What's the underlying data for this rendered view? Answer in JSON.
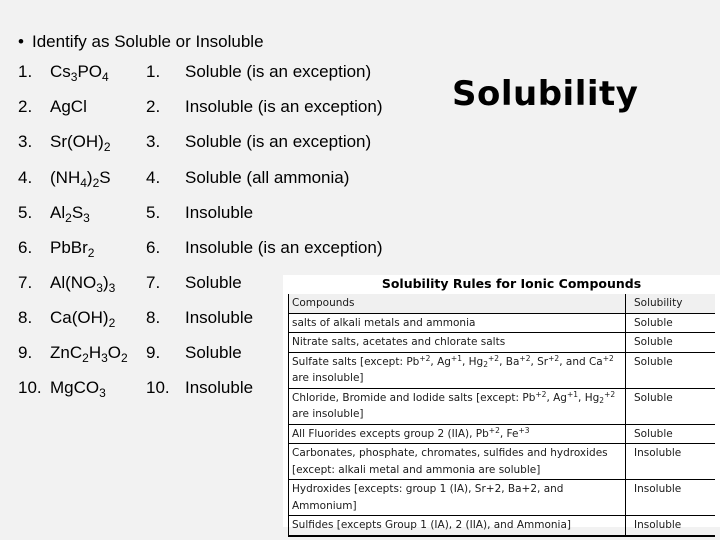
{
  "slide": {
    "title": "Solubility",
    "bullet": "Identify as Soluble or Insoluble",
    "bullet_icon": "bullet-dot"
  },
  "questions": [
    {
      "num": "1.",
      "formula_parts": [
        [
          "Cs",
          ""
        ],
        [
          "3",
          "sub"
        ],
        [
          "PO",
          ""
        ],
        [
          "4",
          "sub"
        ]
      ],
      "answer_num": "1.",
      "answer": "Soluble (is an exception)"
    },
    {
      "num": "2.",
      "formula_parts": [
        [
          "AgCl",
          ""
        ]
      ],
      "answer_num": "2.",
      "answer": "Insoluble (is an exception)"
    },
    {
      "num": "3.",
      "formula_parts": [
        [
          "Sr(OH)",
          ""
        ],
        [
          "2",
          "sub"
        ]
      ],
      "answer_num": "3.",
      "answer": "Soluble (is an exception)"
    },
    {
      "num": "4.",
      "formula_parts": [
        [
          "(NH",
          ""
        ],
        [
          "4",
          "sub"
        ],
        [
          ")",
          ""
        ],
        [
          "2",
          "sub"
        ],
        [
          "S",
          ""
        ]
      ],
      "answer_num": "4.",
      "answer": "Soluble (all ammonia)"
    },
    {
      "num": "5.",
      "formula_parts": [
        [
          "Al",
          ""
        ],
        [
          "2",
          "sub"
        ],
        [
          "S",
          ""
        ],
        [
          "3",
          "sub"
        ]
      ],
      "answer_num": "5.",
      "answer": "Insoluble"
    },
    {
      "num": "6.",
      "formula_parts": [
        [
          "PbBr",
          ""
        ],
        [
          "2",
          "sub"
        ]
      ],
      "answer_num": "6.",
      "answer": "Insoluble (is an exception)"
    },
    {
      "num": "7.",
      "formula_parts": [
        [
          "Al(NO",
          ""
        ],
        [
          "3",
          "sub"
        ],
        [
          ")",
          ""
        ],
        [
          "3",
          "sub"
        ]
      ],
      "answer_num": "7.",
      "answer": "Soluble"
    },
    {
      "num": "8.",
      "formula_parts": [
        [
          "Ca(OH)",
          ""
        ],
        [
          "2",
          "sub"
        ]
      ],
      "answer_num": "8.",
      "answer": "Insoluble"
    },
    {
      "num": "9.",
      "formula_parts": [
        [
          "ZnC",
          ""
        ],
        [
          "2",
          "sub"
        ],
        [
          "H",
          ""
        ],
        [
          "3",
          "sub"
        ],
        [
          "O",
          ""
        ],
        [
          "2",
          "sub"
        ]
      ],
      "answer_num": "9.",
      "answer": "Soluble"
    },
    {
      "num": "10.",
      "formula_parts": [
        [
          "MgCO",
          ""
        ],
        [
          "3",
          "sub"
        ]
      ],
      "answer_num": "10.",
      "answer": "Insoluble"
    }
  ],
  "rules_table": {
    "title": "Solubility Rules for Ionic Compounds",
    "headers": [
      "Compounds",
      "Solubility"
    ],
    "rows": [
      {
        "compound": [
          [
            "salts of alkali metals and ammonia",
            ""
          ]
        ],
        "solubility": "Soluble"
      },
      {
        "compound": [
          [
            "Nitrate salts, acetates and chlorate salts",
            ""
          ]
        ],
        "solubility": "Soluble"
      },
      {
        "compound": [
          [
            "Sulfate salts [except:  Pb",
            ""
          ],
          [
            "+2",
            "sup"
          ],
          [
            ", Ag",
            ""
          ],
          [
            "+1",
            "sup"
          ],
          [
            ", Hg",
            ""
          ],
          [
            "2",
            "sbs"
          ],
          [
            "+2",
            "sup"
          ],
          [
            ",  Ba",
            ""
          ],
          [
            "+2",
            "sup"
          ],
          [
            ", Sr",
            ""
          ],
          [
            "+2",
            "sup"
          ],
          [
            ", and Ca",
            ""
          ],
          [
            "+2",
            "sup"
          ],
          [
            " are insoluble]",
            ""
          ]
        ],
        "solubility": "Soluble"
      },
      {
        "compound": [
          [
            "Chloride, Bromide and Iodide salts [except:  Pb",
            ""
          ],
          [
            "+2",
            "sup"
          ],
          [
            ", Ag",
            ""
          ],
          [
            "+1",
            "sup"
          ],
          [
            ", Hg",
            ""
          ],
          [
            "2",
            "sbs"
          ],
          [
            "+2",
            "sup"
          ],
          [
            " are insoluble]",
            ""
          ]
        ],
        "solubility": "Soluble"
      },
      {
        "compound": [
          [
            " All Fluorides excepts group 2 (IIA), Pb",
            ""
          ],
          [
            "+2",
            "sup"
          ],
          [
            ", Fe",
            ""
          ],
          [
            "+3",
            "sup"
          ]
        ],
        "solubility": "Soluble"
      },
      {
        "compound": [
          [
            "Carbonates, phosphate, chromates, sulfides and hydroxides [except: alkali metal and ammonia are soluble]",
            ""
          ]
        ],
        "solubility": "Insoluble"
      },
      {
        "compound": [
          [
            "Hydroxides [excepts:  group 1 (IA), Sr+2, Ba+2, and Ammonium]",
            ""
          ]
        ],
        "solubility": "Insoluble"
      },
      {
        "compound": [
          [
            "Sulfides [excepts Group 1 (IA), 2 (IIA), and Ammonia]",
            ""
          ]
        ],
        "solubility": "Insoluble"
      }
    ]
  }
}
